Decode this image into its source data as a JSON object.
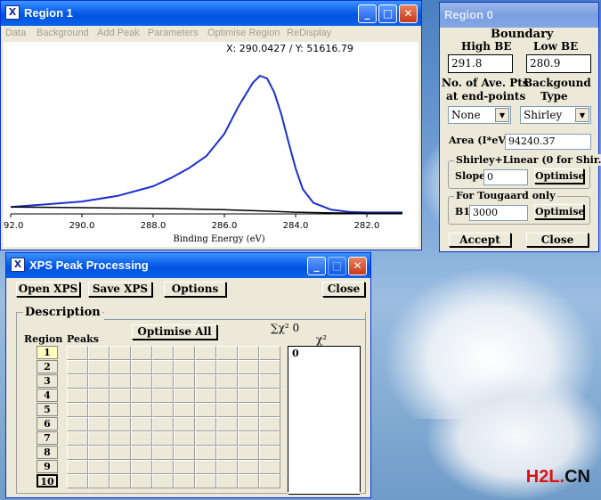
{
  "region1": {
    "title": "Region 1",
    "menu": [
      "Data",
      "Background",
      "Add Peak",
      "Parameters",
      "Optimise Region",
      "ReDisplay"
    ],
    "coord_readout": "X: 290.0427 / Y: 51616.79",
    "xlabel": "Binding Energy (eV)",
    "xticks": [
      "292.0",
      "290.0",
      "288.0",
      "286.0",
      "284.0",
      "282.0"
    ]
  },
  "chart_data": {
    "type": "line",
    "xlabel": "Binding Energy (eV)",
    "xlim": [
      292.0,
      281.0
    ],
    "x_reversed": true,
    "series": [
      {
        "color": "#1a2fd0",
        "x": [
          292,
          291,
          290,
          289,
          288,
          287.5,
          287,
          286.5,
          286,
          285.6,
          285.2,
          285.0,
          284.8,
          284.6,
          284.4,
          284.2,
          284.0,
          283.8,
          283.5,
          283.0,
          282.5,
          282,
          281.5,
          281
        ],
        "y": [
          0.05,
          0.07,
          0.09,
          0.13,
          0.2,
          0.26,
          0.33,
          0.42,
          0.58,
          0.78,
          0.95,
          1.0,
          0.98,
          0.88,
          0.72,
          0.52,
          0.33,
          0.18,
          0.08,
          0.03,
          0.015,
          0.01,
          0.01,
          0.01
        ]
      },
      {
        "color": "#000000",
        "x": [
          292,
          290,
          288,
          286,
          284.8,
          284,
          283,
          282,
          281
        ],
        "y": [
          0.05,
          0.045,
          0.04,
          0.03,
          0.02,
          0.012,
          0.007,
          0.005,
          0.005
        ]
      }
    ]
  },
  "region0": {
    "title": "Region 0",
    "boundary": "Boundary",
    "high_be_label": "High BE",
    "low_be_label": "Low BE",
    "high_be": "291.8",
    "low_be": "280.9",
    "ave_pts_label1": "No. of Ave. Pts",
    "ave_pts_label2": "at end-points",
    "bg_type_label1": "Backgound",
    "bg_type_label2": "Type",
    "ave_pts_value": "None",
    "bg_type_value": "Shirley",
    "area_label": "Area (I*eV)",
    "area_value": "94240.37",
    "shirley_group": "Shirley+Linear (0 for Shir.)",
    "slope_label": "Slope",
    "slope_value": "0",
    "optimise": "Optimise",
    "tougaard_group": "For Tougaard only",
    "b1_label": "B1",
    "b1_value": "3000",
    "accept": "Accept",
    "close": "Close"
  },
  "xps": {
    "title": "XPS Peak Processing",
    "open": "Open XPS",
    "save": "Save XPS",
    "options": "Options",
    "close": "Close",
    "description_label": "Description",
    "optimise_all": "Optimise All",
    "sum_chi": "∑χ² 0",
    "region_label": "Region",
    "peaks_label": "Peaks",
    "chi_label": "χ²",
    "regions": [
      "1",
      "2",
      "3",
      "4",
      "5",
      "6",
      "7",
      "8",
      "9",
      "10"
    ],
    "chi_values": [
      "0",
      "",
      "",
      "",
      "",
      "",
      "",
      "",
      "",
      "",
      ""
    ]
  },
  "watermark": {
    "h2l": "H2L",
    "dot": ".",
    "cn": "CN"
  }
}
